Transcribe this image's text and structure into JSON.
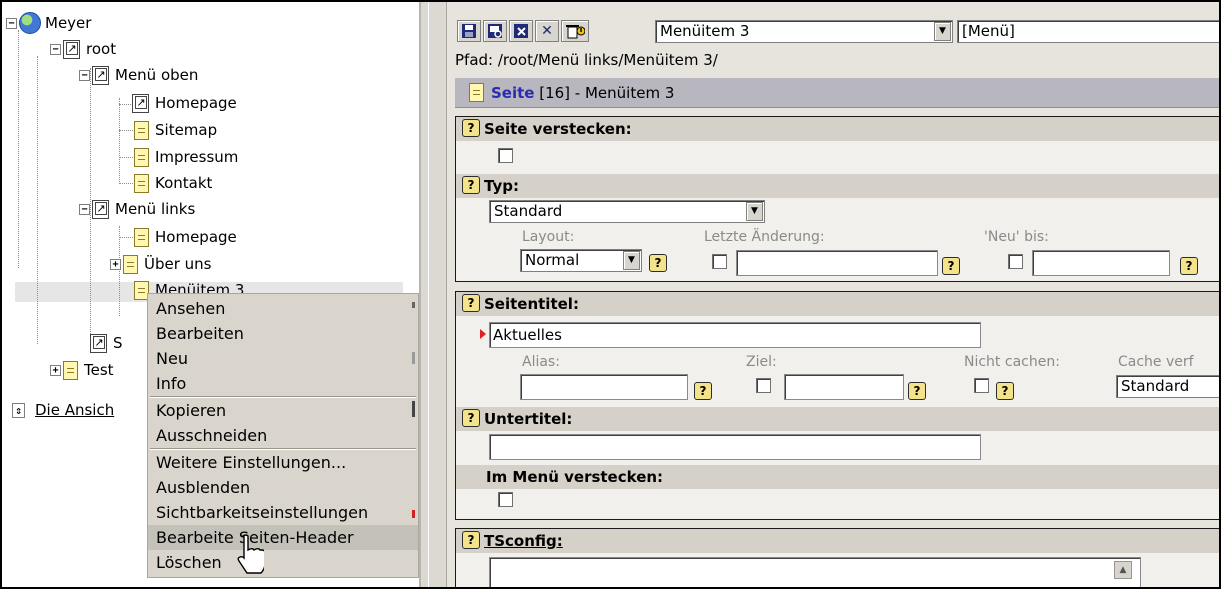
{
  "tree": {
    "nodes": [
      {
        "label": "Meyer",
        "icon": "globe-icon"
      },
      {
        "label": "root",
        "icon": "shortcut-page-icon"
      },
      {
        "label": "Menü oben",
        "icon": "shortcut-page-icon"
      },
      {
        "label": "Homepage",
        "icon": "shortcut-page-icon"
      },
      {
        "label": "Sitemap",
        "icon": "page-icon"
      },
      {
        "label": "Impressum",
        "icon": "page-icon"
      },
      {
        "label": "Kontakt",
        "icon": "page-icon"
      },
      {
        "label": "Menü links",
        "icon": "shortcut-page-icon"
      },
      {
        "label": "Homepage",
        "icon": "page-icon"
      },
      {
        "label": "Über uns",
        "icon": "page-icon"
      },
      {
        "label": "Menüitem 3",
        "icon": "page-icon"
      },
      {
        "label": "S",
        "icon": "shortcut-page-icon"
      },
      {
        "label": "Test",
        "icon": "page-icon"
      }
    ],
    "view_link": "Die Ansich",
    "expand_sign": "+",
    "collapse_sign": "−"
  },
  "context_menu": {
    "items": [
      "Ansehen",
      "Bearbeiten",
      "Neu",
      "Info",
      "Kopieren",
      "Ausschneiden",
      "Weitere Einstellungen...",
      "Ausblenden",
      "Sichtbarkeitseinstellungen",
      "Bearbeite Seiten-Header",
      "Löschen"
    ],
    "highlighted_index": 9
  },
  "toolbar": {
    "buttons": [
      "save-icon",
      "save-view-icon",
      "save-close-icon",
      "close-icon",
      "delete-icon"
    ],
    "close_glyph": "✕",
    "record_select": "Menüitem 3",
    "type_select": "[Menü]"
  },
  "path": "Pfad: /root/Menü links/Menüitem 3/",
  "header": {
    "link": "Seite",
    "rest": " [16] - Menüitem 3"
  },
  "form": {
    "hide_page_label": "Seite verstecken:",
    "type_label": "Typ:",
    "type_value": "Standard",
    "layout_label": "Layout:",
    "layout_value": "Normal",
    "last_change_label": "Letzte Änderung:",
    "new_until_label": "'Neu' bis:",
    "page_title_label": "Seitentitel:",
    "page_title_value": "Aktuelles",
    "alias_label": "Alias:",
    "target_label": "Ziel:",
    "no_cache_label": "Nicht cachen:",
    "cache_label": "Cache verf",
    "cache_value": "Standard",
    "subtitle_label": "Untertitel:",
    "hide_menu_label": "Im Menü verstecken:",
    "tsconfig_label": "TSconfig:",
    "help_glyph": "?",
    "arrow_glyph": "▼",
    "up_glyph": "▲"
  }
}
